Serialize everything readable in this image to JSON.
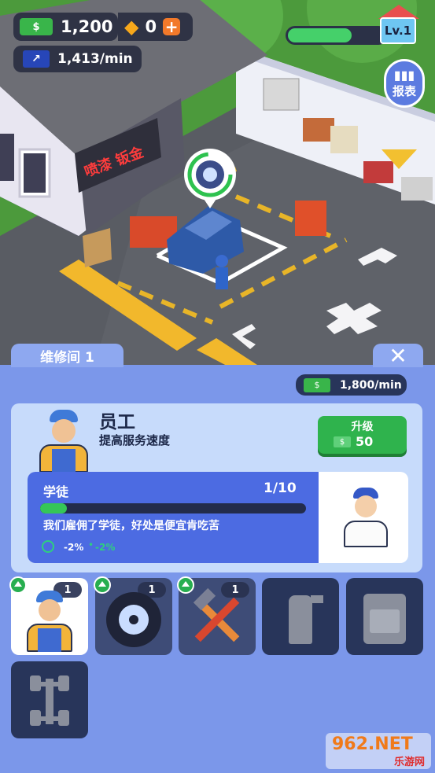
{
  "hud": {
    "cash": "1,200",
    "gems": "0",
    "income_rate": "1,413/min",
    "level": "Lv.1",
    "level_progress": 0.65,
    "report_label": "报表"
  },
  "scene": {
    "sign_text": "喷漆 钣金"
  },
  "panel": {
    "tab_title": "维修间 1",
    "income_rate": "1,800/min",
    "category": {
      "title": "员工",
      "subtitle": "提高服务速度",
      "upgrade_label": "升级",
      "upgrade_cost": "50"
    },
    "worker": {
      "rank": "学徒",
      "progress_text": "1/10",
      "progress": 0.1,
      "description": "我们雇佣了学徒，好处是便宜肯吃苦",
      "stat_a": "-2%",
      "stat_b": "-2%"
    },
    "slots": [
      {
        "name": "worker",
        "count": "1",
        "locked": false,
        "selected": true
      },
      {
        "name": "tire",
        "count": "1",
        "locked": false,
        "selected": false
      },
      {
        "name": "tools",
        "count": "1",
        "locked": false,
        "selected": false
      },
      {
        "name": "spray-can",
        "locked": true
      },
      {
        "name": "oil-can",
        "locked": true
      },
      {
        "name": "chassis",
        "locked": true
      }
    ]
  },
  "watermark": {
    "site": "962.NET",
    "caption": "乐游网"
  }
}
